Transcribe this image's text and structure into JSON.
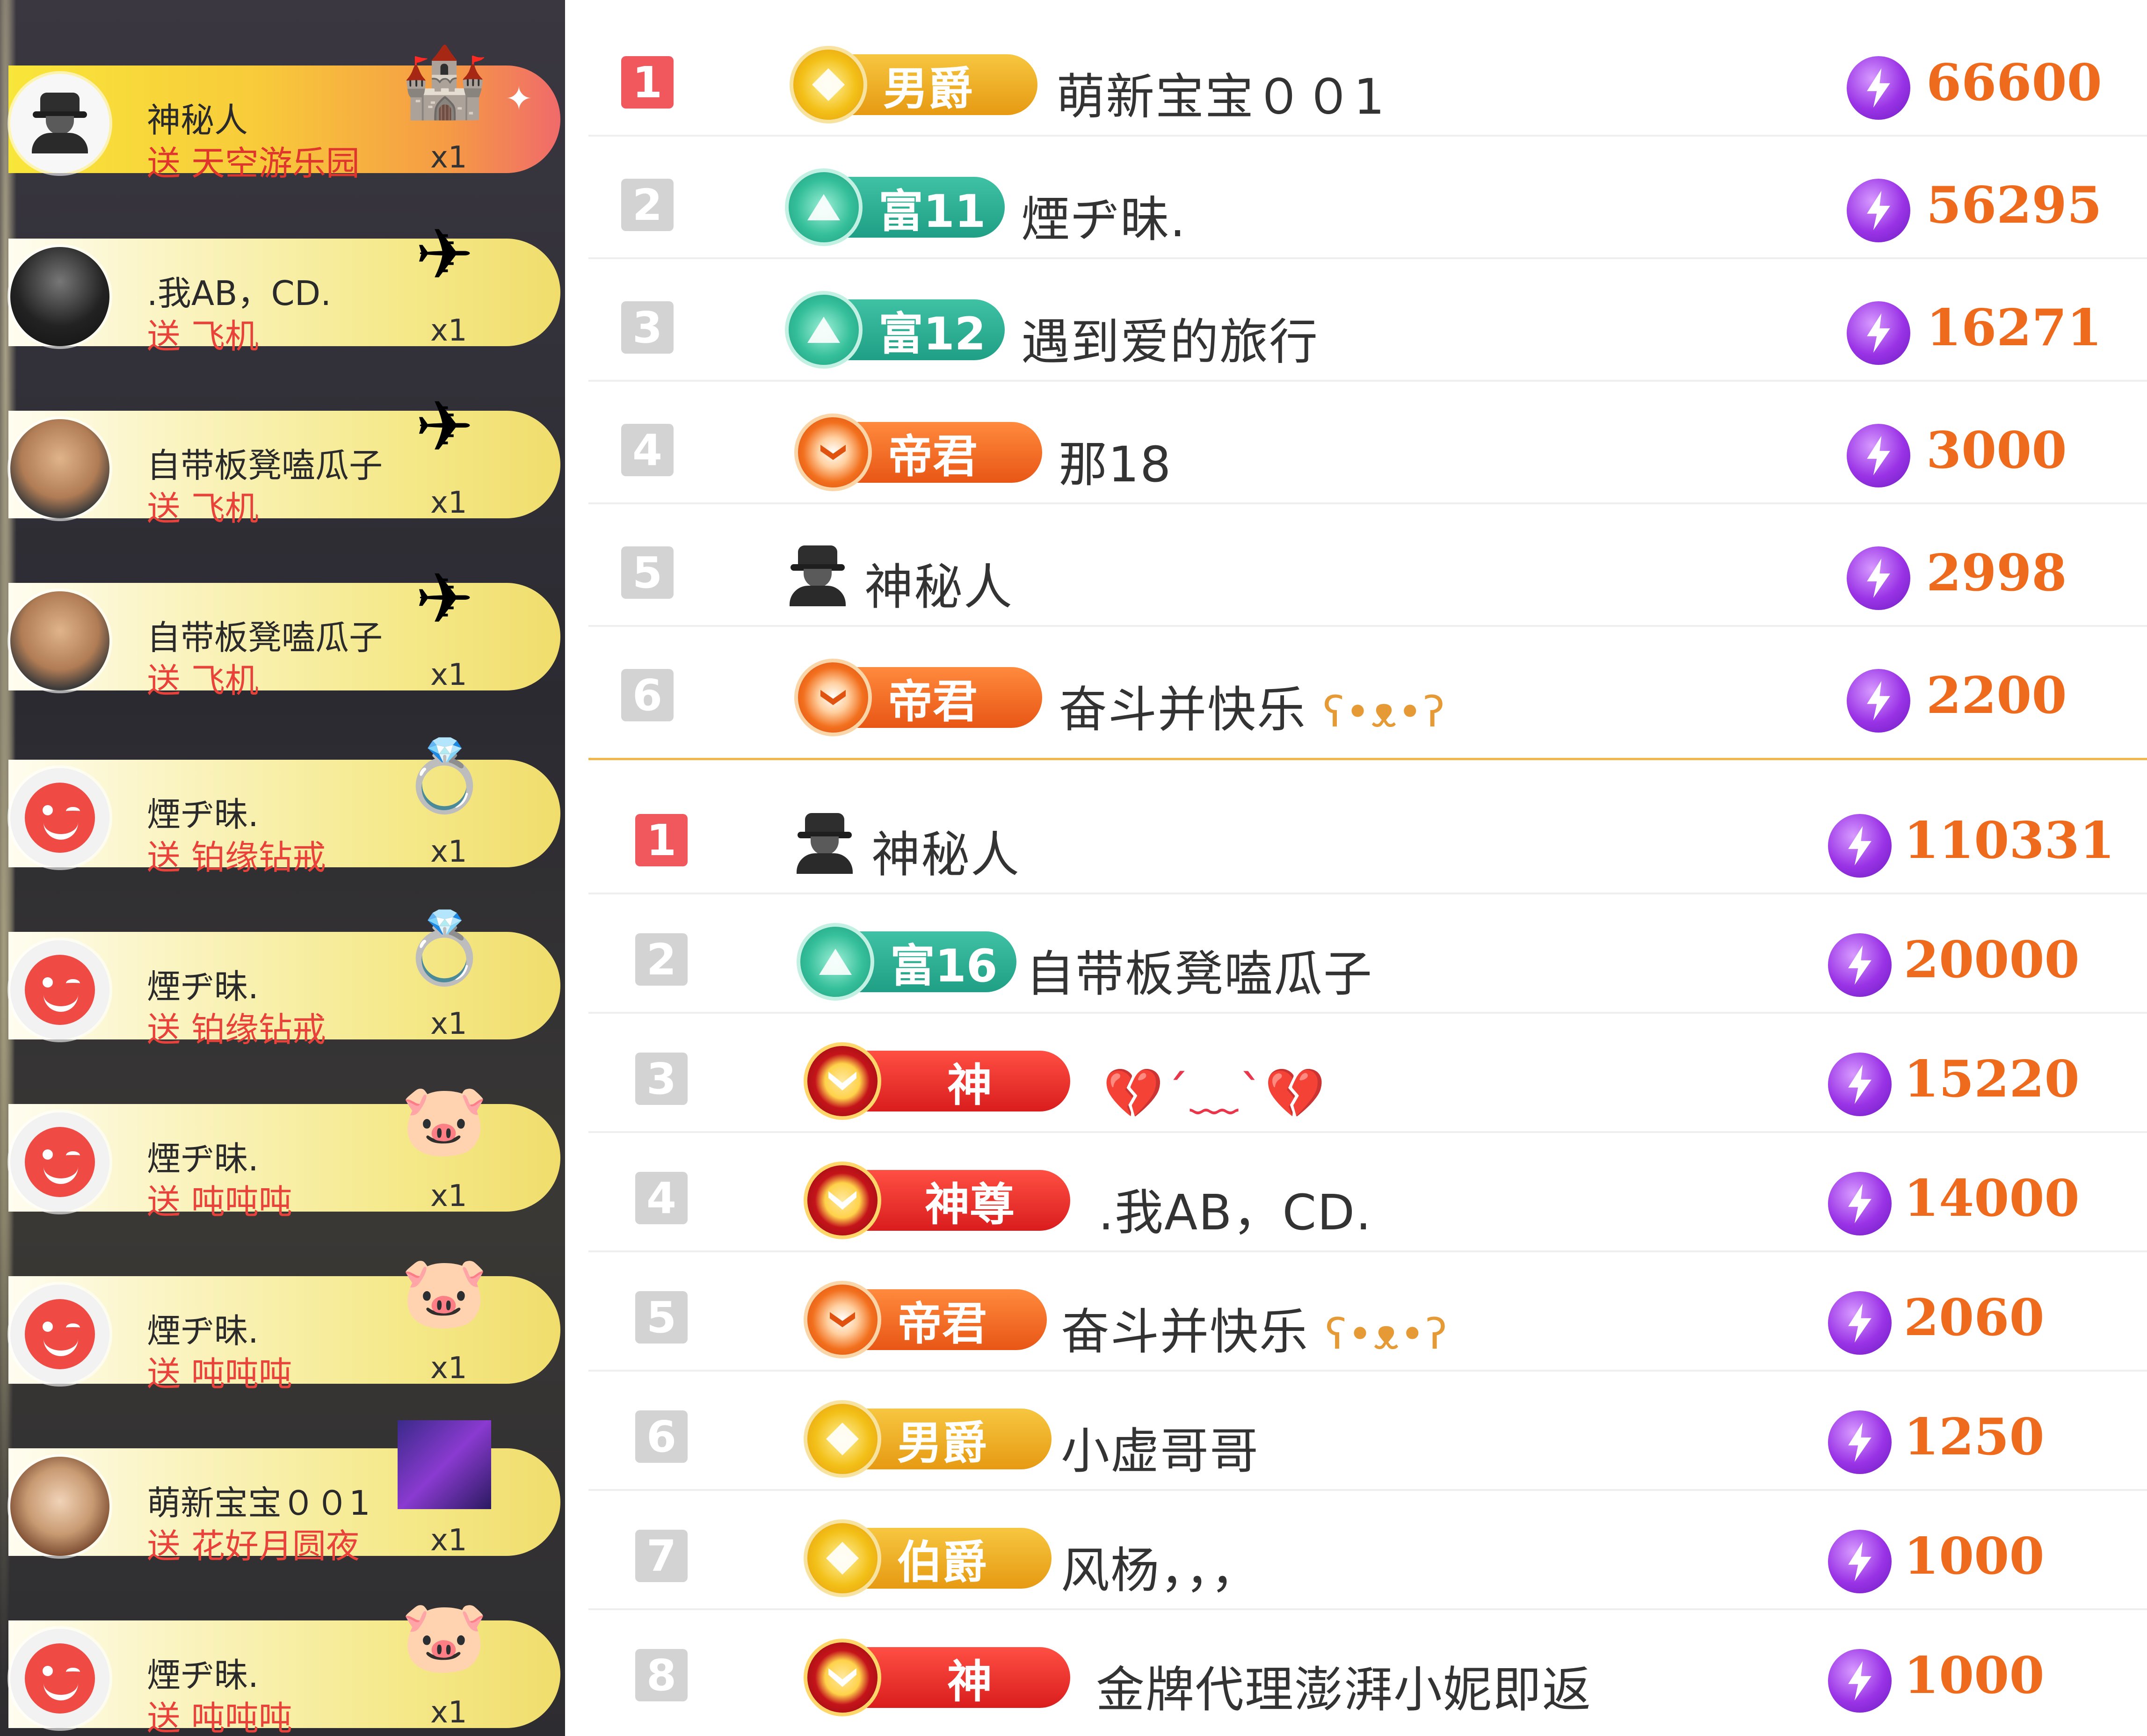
{
  "gift_feed": {
    "items": [
      {
        "user": "神秘人",
        "text": "送 天空游乐园",
        "count": "x1",
        "gift_icon": "castle-icon",
        "avatar": "mystery"
      },
      {
        "user": ".我AB，CD.",
        "text": "送 飞机",
        "count": "x1",
        "gift_icon": "airplane-icon",
        "avatar": "dark"
      },
      {
        "user": "自带板凳嗑瓜子",
        "text": "送 飞机",
        "count": "x1",
        "gift_icon": "airplane-icon",
        "avatar": "face"
      },
      {
        "user": "自带板凳嗑瓜子",
        "text": "送 飞机",
        "count": "x1",
        "gift_icon": "airplane-icon",
        "avatar": "face"
      },
      {
        "user": "煙ヂ昧.",
        "text": "送 铂缘钻戒",
        "count": "x1",
        "gift_icon": "ring-box-icon",
        "avatar": "smile"
      },
      {
        "user": "煙ヂ昧.",
        "text": "送 铂缘钻戒",
        "count": "x1",
        "gift_icon": "ring-box-icon",
        "avatar": "smile"
      },
      {
        "user": "煙ヂ昧.",
        "text": "送 吨吨吨",
        "count": "x1",
        "gift_icon": "wizard-pig-icon",
        "avatar": "smile"
      },
      {
        "user": "煙ヂ昧.",
        "text": "送 吨吨吨",
        "count": "x1",
        "gift_icon": "wizard-pig-icon",
        "avatar": "smile"
      },
      {
        "user": "萌新宝宝００1",
        "text": "送 花好月圆夜",
        "count": "x1",
        "gift_icon": "moon-night-icon",
        "avatar": "baby"
      },
      {
        "user": "煙ヂ昧.",
        "text": "送 吨吨吨",
        "count": "x1",
        "gift_icon": "wizard-pig-icon",
        "avatar": "smile"
      }
    ]
  },
  "board_top": {
    "rows": [
      {
        "rank": "1",
        "badge": "男爵",
        "badge_type": "noble",
        "name": "萌新宝宝００1",
        "score": "66600"
      },
      {
        "rank": "2",
        "badge": "富11",
        "badge_type": "rich",
        "name": "煙ヂ昧.",
        "score": "56295"
      },
      {
        "rank": "3",
        "badge": "富12",
        "badge_type": "rich",
        "name": "遇到爱的旅行",
        "score": "16271"
      },
      {
        "rank": "4",
        "badge": "帝君",
        "badge_type": "emperor",
        "name": "那18",
        "score": "3000"
      },
      {
        "rank": "5",
        "badge": "",
        "badge_type": "mystery",
        "name": "神秘人",
        "score": "2998"
      },
      {
        "rank": "6",
        "badge": "帝君",
        "badge_type": "emperor",
        "name": "奋斗并快乐",
        "score": "2200"
      }
    ]
  },
  "board_bottom": {
    "rows": [
      {
        "rank": "1",
        "badge": "",
        "badge_type": "mystery",
        "name": "神秘人",
        "score": "110331"
      },
      {
        "rank": "2",
        "badge": "富16",
        "badge_type": "rich",
        "name": "自带板凳嗑瓜子",
        "score": "20000"
      },
      {
        "rank": "3",
        "badge": "神",
        "badge_type": "god",
        "name": "💔ˊ﹏ˋ💔",
        "score": "15220"
      },
      {
        "rank": "4",
        "badge": "神尊",
        "badge_type": "god",
        "name": ".我AB，CD.",
        "score": "14000"
      },
      {
        "rank": "5",
        "badge": "帝君",
        "badge_type": "emperor",
        "name": "奋斗并快乐",
        "score": "2060"
      },
      {
        "rank": "6",
        "badge": "男爵",
        "badge_type": "noble",
        "name": "小虚哥哥",
        "score": "1250"
      },
      {
        "rank": "7",
        "badge": "伯爵",
        "badge_type": "noble",
        "name": "风杨，，，",
        "score": "1000"
      },
      {
        "rank": "8",
        "badge": "神",
        "badge_type": "god",
        "name": "金牌代理澎湃小妮即返",
        "score": "1000"
      }
    ]
  },
  "colors": {
    "score": "#ee6a1c",
    "top_rank": "#f0585d",
    "divider": "#f2b74a",
    "gift_text": "#e8423a"
  }
}
